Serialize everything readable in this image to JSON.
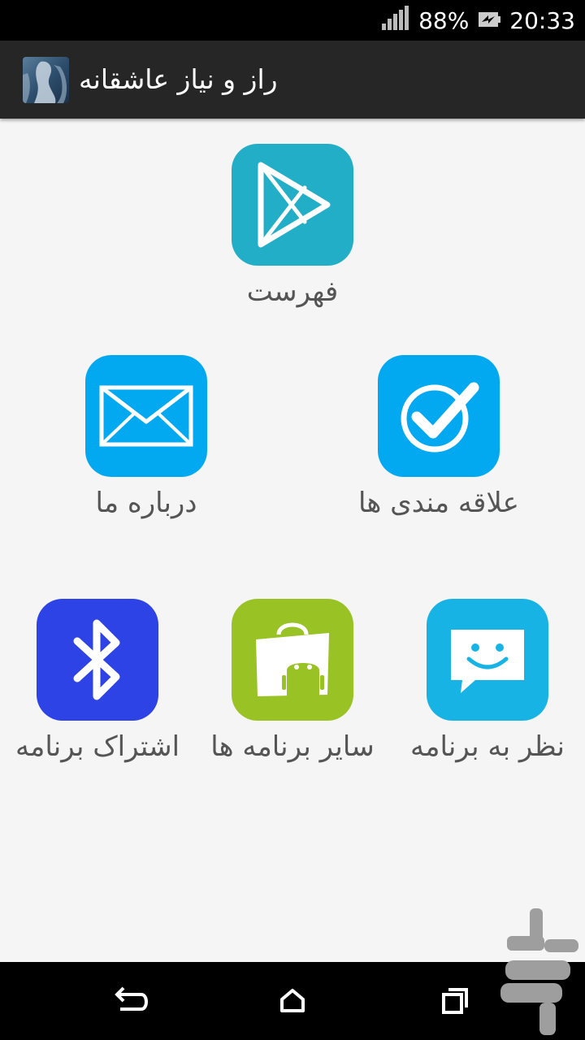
{
  "status_bar": {
    "battery": "88%",
    "time": "20:33"
  },
  "app_bar": {
    "title": "راز و نیاز عاشقانه",
    "icon": "app-thumbnail"
  },
  "menu": [
    {
      "label": "فهرست",
      "icon": "play-store-icon",
      "color": "#22aec7"
    },
    {
      "label": "درباره ما",
      "icon": "envelope-icon",
      "color": "#03a9f0"
    },
    {
      "label": "علاقه مندی ها",
      "icon": "checkmark-circle-icon",
      "color": "#03a9f0"
    },
    {
      "label": "اشتراک برنامه",
      "icon": "bluetooth-icon",
      "color": "#2d43e6"
    },
    {
      "label": "سایر برنامه ها",
      "icon": "android-bag-icon",
      "color": "#99c225"
    },
    {
      "label": "نظر به برنامه",
      "icon": "chat-bubble-smile-icon",
      "color": "#17b3e4"
    }
  ],
  "nav_bar": {
    "back": "back-icon",
    "home": "home-icon",
    "recents": "recents-icon"
  }
}
